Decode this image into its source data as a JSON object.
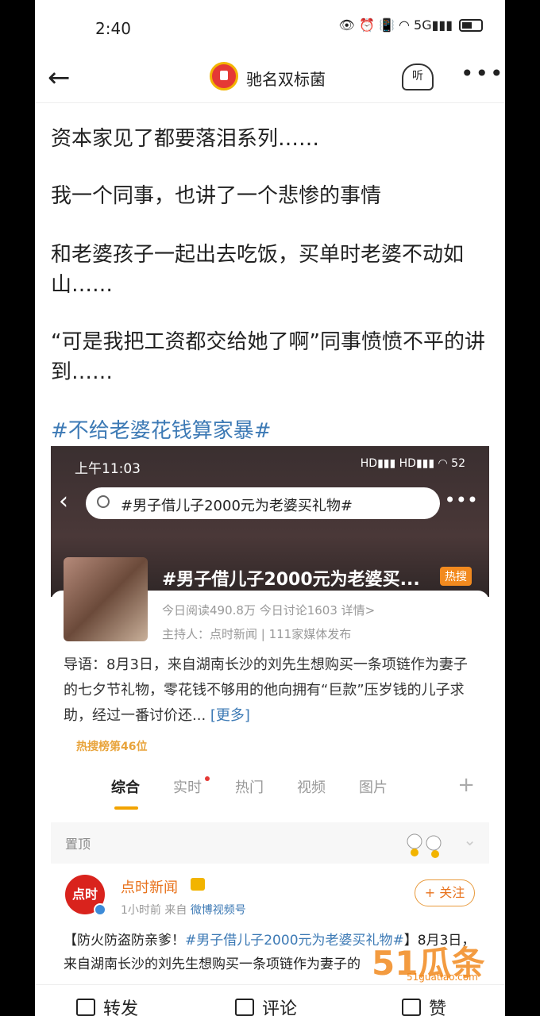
{
  "statusbar": {
    "time": "2:40",
    "icons": "👁 ⏰ 📳 ◠ 5G▮▮▮"
  },
  "nav": {
    "back_icon": "arrow-left-icon",
    "title": "驰名双标菌",
    "listen_label": "听",
    "more_label": "•••"
  },
  "post": {
    "paragraphs": [
      "资本家见了都要落泪系列……",
      "我一个同事，也讲了一个悲惨的事情",
      "和老婆孩子一起出去吃饭，买单时老婆不动如山……",
      "“可是我把工资都交给她了啊”同事愤愤不平的讲到……"
    ],
    "hashtag": "#不给老婆花钱算家暴#"
  },
  "embed": {
    "time": "上午11:03",
    "icons": "HD▮▮▮ HD▮▮▮ ◠ 52",
    "search_text": "#男子借儿子2000元为老婆买礼物#",
    "more_label": "•••",
    "topic_title": "#男子借儿子2000元为老婆买...",
    "hot_badge": "热搜",
    "stats": "今日阅读490.8万   今日讨论1603   详情>",
    "host": "主持人：点时新闻 | 111家媒体发布",
    "lead": "导语：8月3日，来自湖南长沙的刘先生想购买一条项链作为妻子的七夕节礼物，零花钱不够用的他向拥有“巨款”压岁钱的儿子求助，经过一番讨价还... ",
    "lead_more": "[更多]",
    "rank": "热搜榜第46位",
    "tabs": [
      "综合",
      "实时",
      "热门",
      "视频",
      "图片"
    ],
    "plus_label": "+",
    "pinned_label": "置顶",
    "author_avatar_text": "点时",
    "author_name": "点时新闻",
    "meta_time": "1小时前  来自 ",
    "meta_source": "微博视频号",
    "follow_label": "+ 关注",
    "post_prefix": "【防火防盗防亲爹！",
    "post_tag": "#男子借儿子2000元为老婆买礼物#",
    "post_suffix": "】8月3日，来自湖南长沙的刘先生想购买一条项链作为妻子的"
  },
  "watermark": {
    "logo": "51瓜条",
    "domain": "51guatiao.com"
  },
  "actions": {
    "repost": "转发",
    "comment": "评论",
    "like": "赞"
  },
  "colors": {
    "link": "#3d7ab5",
    "accent": "#f2a300",
    "orange": "#e8721c"
  }
}
